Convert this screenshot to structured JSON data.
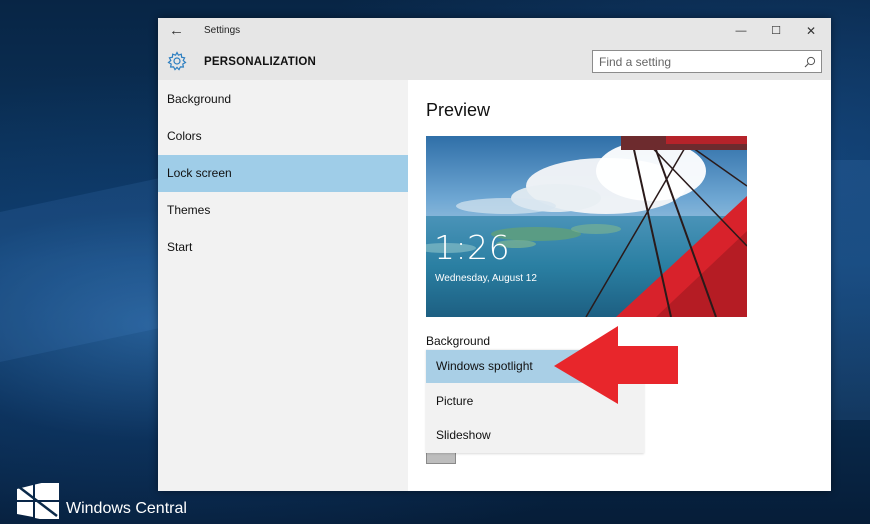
{
  "window": {
    "title": "Settings",
    "back_icon": "back-arrow-icon",
    "controls": {
      "minimize": "—",
      "maximize": "☐",
      "close": "✕"
    }
  },
  "header": {
    "icon": "gear-icon",
    "title": "PERSONALIZATION",
    "search": {
      "placeholder": "Find a setting",
      "value": "",
      "icon": "search-icon"
    }
  },
  "sidebar": {
    "items": [
      {
        "label": "Background",
        "selected": false
      },
      {
        "label": "Colors",
        "selected": false
      },
      {
        "label": "Lock screen",
        "selected": true
      },
      {
        "label": "Themes",
        "selected": false
      },
      {
        "label": "Start",
        "selected": false
      }
    ]
  },
  "main": {
    "heading": "Preview",
    "preview": {
      "time": "1:26",
      "date": "Wednesday, August 12"
    },
    "background": {
      "label": "Background",
      "options": [
        {
          "label": "Windows spotlight",
          "selected": true
        },
        {
          "label": "Picture",
          "selected": false
        },
        {
          "label": "Slideshow",
          "selected": false
        }
      ]
    }
  },
  "overlay": {
    "arrow": "red-arrow-icon",
    "color": "#e8262b"
  },
  "watermark": {
    "text": "Windows Central"
  },
  "colors": {
    "accent_selected": "#9fcde8",
    "sidebar_bg": "#f2f2f2",
    "titlebar_bg": "#e6e6e6"
  }
}
